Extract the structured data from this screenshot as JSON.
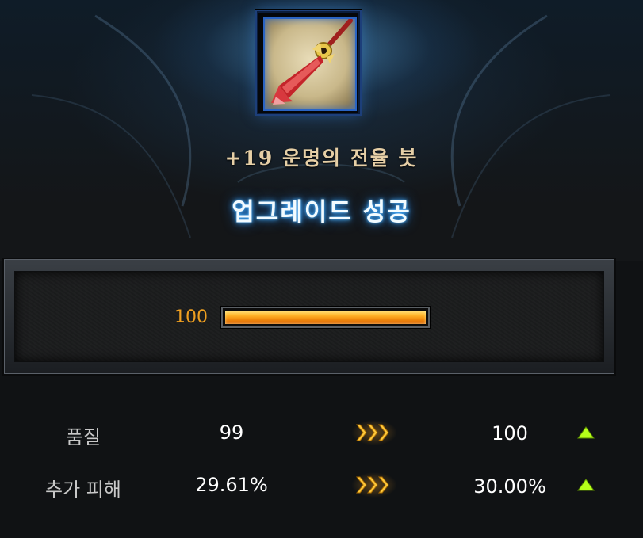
{
  "item": {
    "name": "+19 운명의 전율 붓",
    "icon": "red-tassel-brush-icon"
  },
  "result": {
    "title": "업그레이드 성공"
  },
  "progress": {
    "value_label": "100",
    "percent": 100
  },
  "stats": [
    {
      "label": "품질",
      "before": "99",
      "after": "100"
    },
    {
      "label": "추가 피해",
      "before": "29.61%",
      "after": "30.00%"
    }
  ],
  "colors": {
    "title_glow": "#39a8ff",
    "progress_value": "#f0a020",
    "increase_arrow": "#b6ff1a",
    "transition_arrow": "#ffc83a"
  },
  "icons": {
    "transition": "triple-chevron-right-icon",
    "increase": "triangle-up-icon"
  }
}
